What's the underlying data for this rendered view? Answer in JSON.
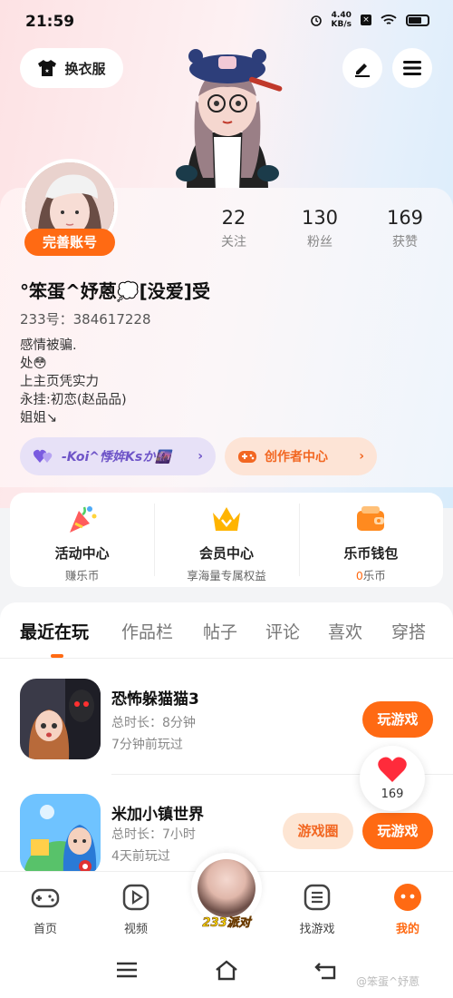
{
  "status_bar": {
    "time": "21:59",
    "speed_value": "4.40",
    "speed_unit": "KB/s"
  },
  "header": {
    "outfit_label": "换衣服"
  },
  "profile": {
    "complete_account_label": "完善账号",
    "stats": [
      {
        "value": "22",
        "label": "关注"
      },
      {
        "value": "130",
        "label": "粉丝"
      },
      {
        "value": "169",
        "label": "获赞"
      }
    ],
    "username": "°笨蛋^妤蒽💭[没爱]受",
    "uid": "233号：384617228",
    "bio_lines": [
      "感情被骗.",
      "处😳",
      "上主页凭实力",
      "永挂:初恋(赵品品)",
      "姐姐↘"
    ],
    "koi_pill_label": "-Koi^悸姩Ksか🌆",
    "creator_pill_label": "创作者中心"
  },
  "services": [
    {
      "title": "活动中心",
      "sub": "赚乐币",
      "icon": "party-popper-icon"
    },
    {
      "title": "会员中心",
      "sub": "享海量专属权益",
      "icon": "crown-icon"
    },
    {
      "title": "乐币钱包",
      "sub_value": "0",
      "sub_unit": "乐币",
      "icon": "wallet-icon"
    }
  ],
  "tabs": [
    "最近在玩",
    "作品栏",
    "帖子",
    "评论",
    "喜欢",
    "穿搭"
  ],
  "games": [
    {
      "name": "恐怖躲猫猫3",
      "duration": "总时长：8分钟",
      "last_played": "7分钟前玩过",
      "play_label": "玩游戏"
    },
    {
      "name": "米加小镇世界",
      "duration": "总时长：7小时",
      "last_played": "4天前玩过",
      "play_label": "玩游戏",
      "circle_label": "游戏圈"
    }
  ],
  "like_float": {
    "count": "169"
  },
  "bottom_nav": {
    "home": "首页",
    "video": "视频",
    "center": "233派对",
    "find_game": "找游戏",
    "me": "我的"
  },
  "watermark": "@笨蛋^妤蒽",
  "colors": {
    "accent": "#ff6a13",
    "koi_purple": "#6f55c8"
  }
}
